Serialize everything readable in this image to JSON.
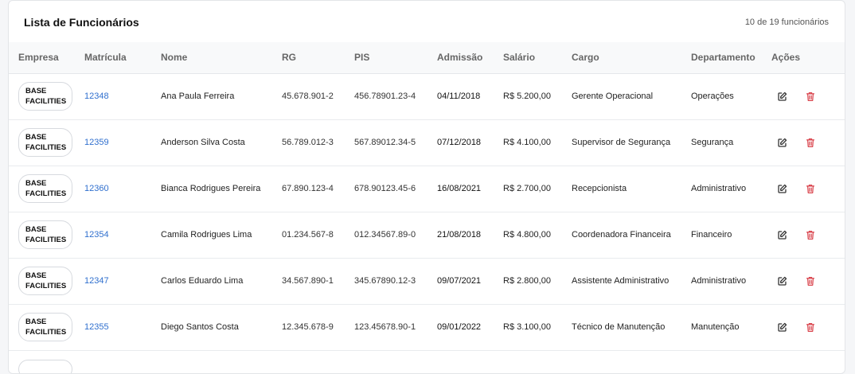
{
  "header": {
    "title": "Lista de Funcionários",
    "count": "10 de 19 funcionários"
  },
  "columns": [
    "Empresa",
    "Matrícula",
    "Nome",
    "RG",
    "PIS",
    "Admissão",
    "Salário",
    "Cargo",
    "Departamento",
    "Ações"
  ],
  "rows": [
    {
      "empresa": "BASE\nFACILITIES",
      "matricula": "12348",
      "nome": "Ana Paula Ferreira",
      "rg": "45.678.901-2",
      "pis": "456.78901.23-4",
      "admissao": "04/11/2018",
      "salario": "R$ 5.200,00",
      "cargo": "Gerente Operacional",
      "departamento": "Operações"
    },
    {
      "empresa": "BASE\nFACILITIES",
      "matricula": "12359",
      "nome": "Anderson Silva Costa",
      "rg": "56.789.012-3",
      "pis": "567.89012.34-5",
      "admissao": "07/12/2018",
      "salario": "R$ 4.100,00",
      "cargo": "Supervisor de Segurança",
      "departamento": "Segurança"
    },
    {
      "empresa": "BASE\nFACILITIES",
      "matricula": "12360",
      "nome": "Bianca Rodrigues Pereira",
      "rg": "67.890.123-4",
      "pis": "678.90123.45-6",
      "admissao": "16/08/2021",
      "salario": "R$ 2.700,00",
      "cargo": "Recepcionista",
      "departamento": "Administrativo"
    },
    {
      "empresa": "BASE\nFACILITIES",
      "matricula": "12354",
      "nome": "Camila Rodrigues Lima",
      "rg": "01.234.567-8",
      "pis": "012.34567.89-0",
      "admissao": "21/08/2018",
      "salario": "R$ 4.800,00",
      "cargo": "Coordenadora Financeira",
      "departamento": "Financeiro"
    },
    {
      "empresa": "BASE\nFACILITIES",
      "matricula": "12347",
      "nome": "Carlos Eduardo Lima",
      "rg": "34.567.890-1",
      "pis": "345.67890.12-3",
      "admissao": "09/07/2021",
      "salario": "R$ 2.800,00",
      "cargo": "Assistente Administrativo",
      "departamento": "Administrativo"
    },
    {
      "empresa": "BASE\nFACILITIES",
      "matricula": "12355",
      "nome": "Diego Santos Costa",
      "rg": "12.345.678-9",
      "pis": "123.45678.90-1",
      "admissao": "09/01/2022",
      "salario": "R$ 3.100,00",
      "cargo": "Técnico de Manutenção",
      "departamento": "Manutenção"
    }
  ],
  "icons": {
    "edit": "edit-icon",
    "delete": "trash-icon"
  },
  "colors": {
    "link": "#2f6fce",
    "delete": "#d9434c",
    "edit": "#333333"
  }
}
